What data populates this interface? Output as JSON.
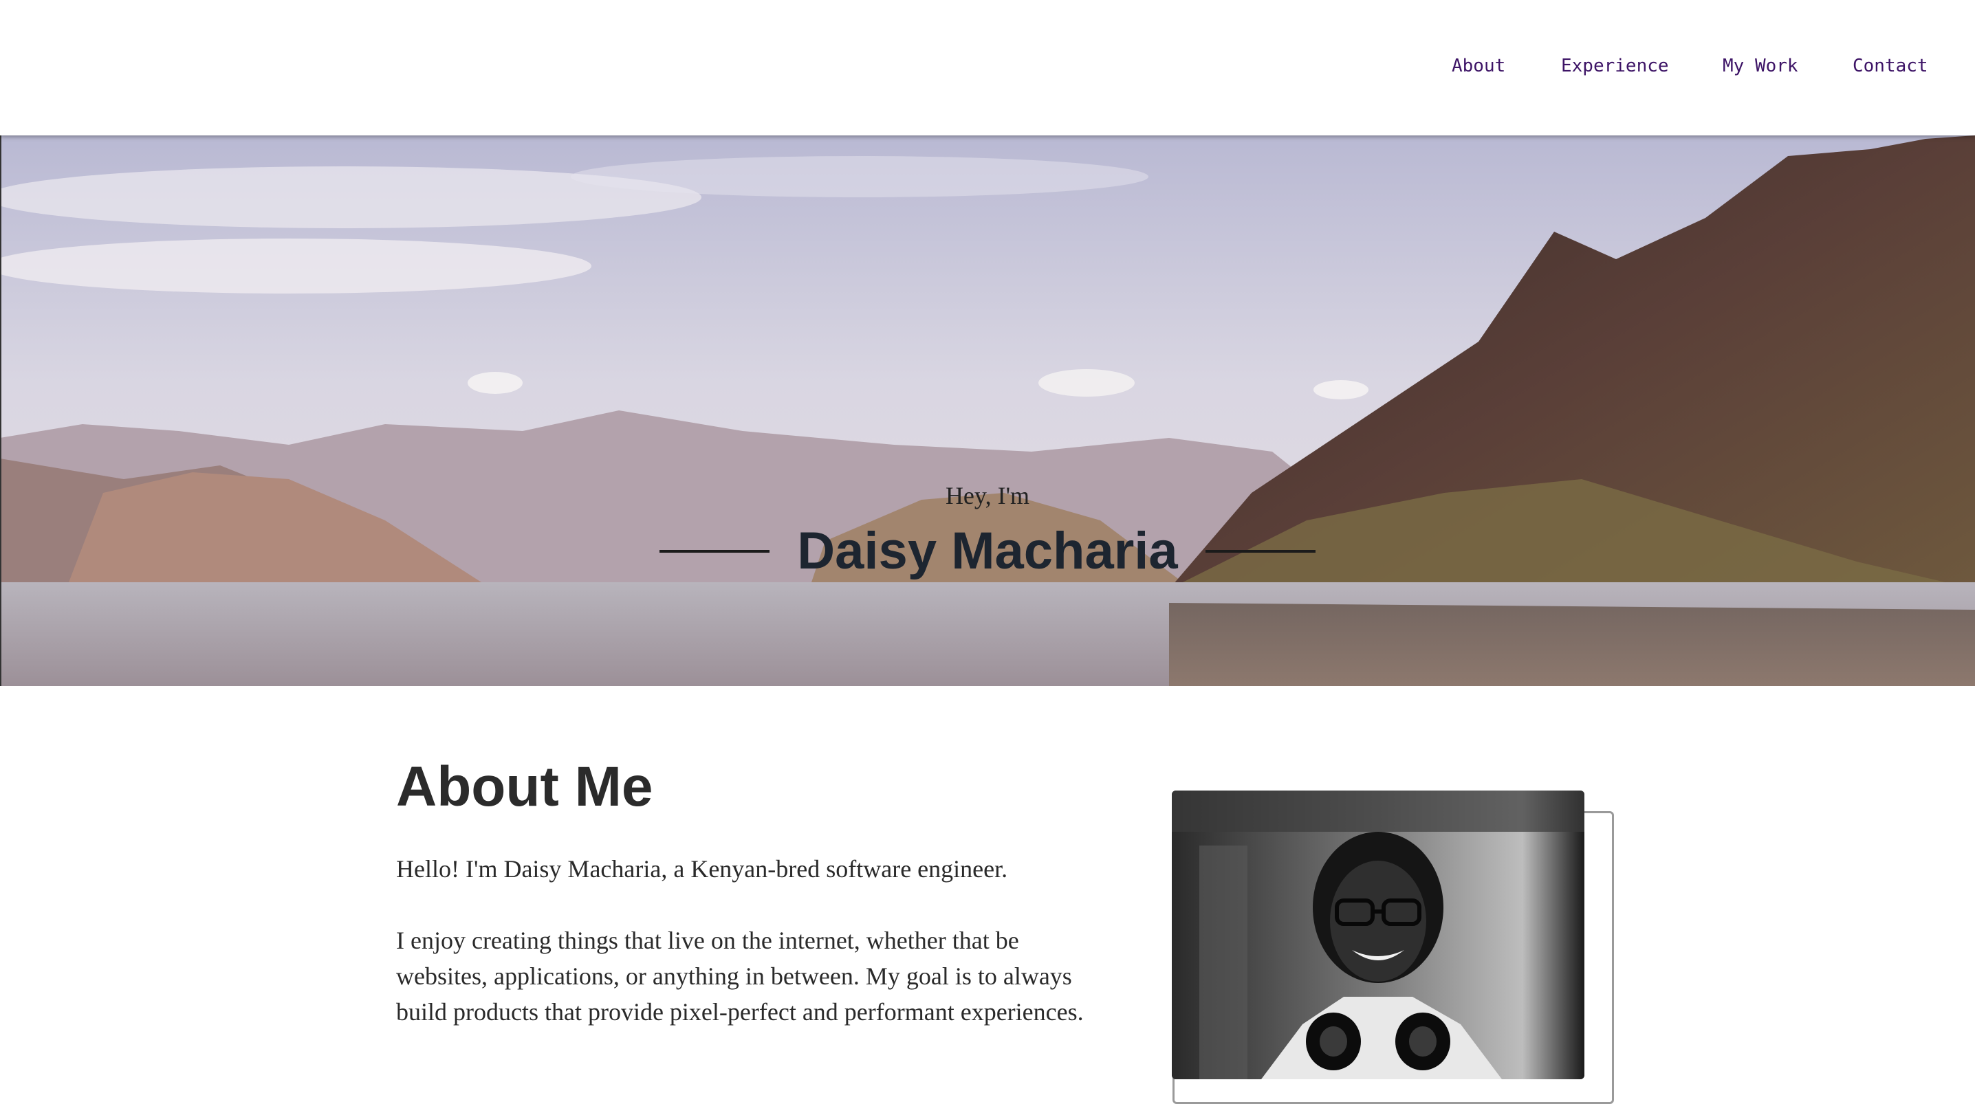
{
  "nav": {
    "links": [
      "About",
      "Experience",
      "My Work",
      "Contact"
    ]
  },
  "hero": {
    "greeting": "Hey, I'm",
    "name": "Daisy Macharia"
  },
  "about": {
    "title": "About Me",
    "paragraphs": [
      "Hello! I'm Daisy Macharia, a Kenyan-bred software engineer.",
      "I enjoy creating things that live on the internet, whether that be websites, applications, or anything in between. My goal is to always build products that provide pixel-perfect and performant experiences."
    ]
  },
  "colors": {
    "nav_link": "#3d1466",
    "heading": "#2b2b2b",
    "body_text": "#2a2a2a"
  }
}
